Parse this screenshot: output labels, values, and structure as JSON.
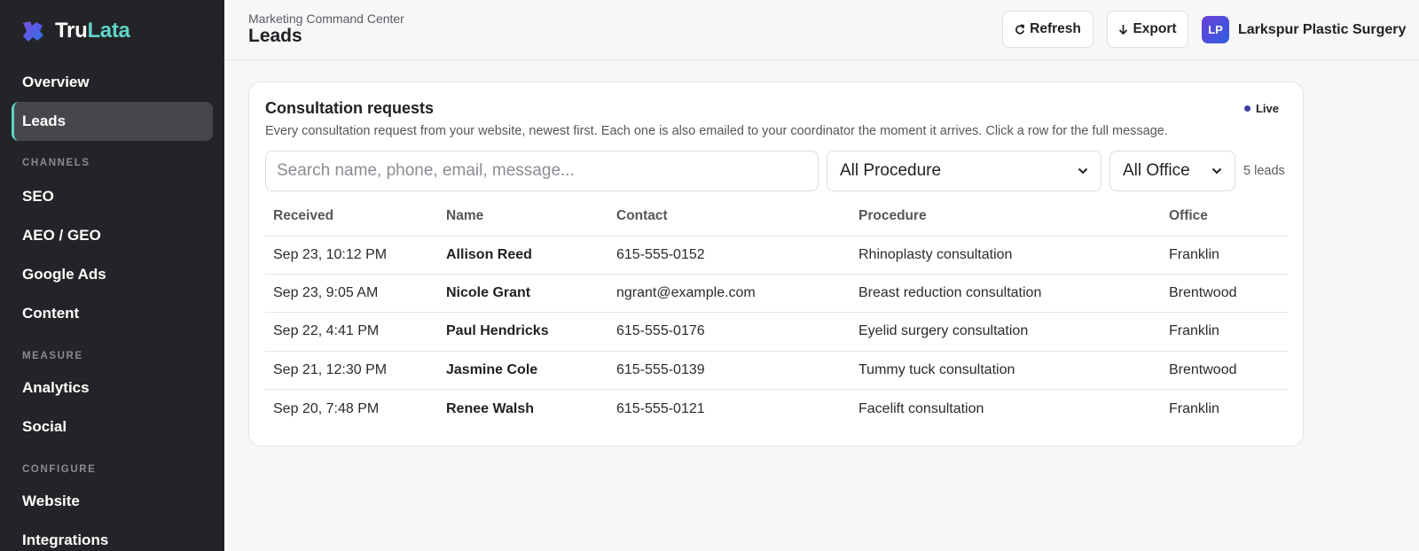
{
  "brand": {
    "prefix": "Tru",
    "suffix": "Lata"
  },
  "sidebar": {
    "items_top": [
      {
        "label": "Overview"
      },
      {
        "label": "Leads"
      }
    ],
    "section_channels": "CHANNELS",
    "items_channels": [
      {
        "label": "SEO"
      },
      {
        "label": "AEO / GEO"
      },
      {
        "label": "Google Ads"
      },
      {
        "label": "Content"
      }
    ],
    "section_measure": "MEASURE",
    "items_measure": [
      {
        "label": "Analytics"
      },
      {
        "label": "Social"
      }
    ],
    "section_configure": "CONFIGURE",
    "items_configure": [
      {
        "label": "Website"
      },
      {
        "label": "Integrations"
      }
    ]
  },
  "header": {
    "breadcrumb": "Marketing Command Center",
    "title": "Leads",
    "refresh_label": "Refresh",
    "export_label": "Export",
    "org_initials": "LP",
    "org_name": "Larkspur Plastic Surgery"
  },
  "card": {
    "title": "Consultation requests",
    "live_label": "Live",
    "description": "Every consultation request from your website, newest first. Each one is also emailed to your coordinator the moment it arrives. Click a row for the full message.",
    "search_placeholder": "Search name, phone, email, message...",
    "procedure_filter": "All Procedure",
    "office_filter": "All Office",
    "leads_count": "5 leads"
  },
  "table": {
    "columns": [
      "Received",
      "Name",
      "Contact",
      "Procedure",
      "Office"
    ],
    "rows": [
      [
        "Sep 23, 10:12 PM",
        "Allison Reed",
        "615-555-0152",
        "Rhinoplasty consultation",
        "Franklin"
      ],
      [
        "Sep 23, 9:05 AM",
        "Nicole Grant",
        "ngrant@example.com",
        "Breast reduction consultation",
        "Brentwood"
      ],
      [
        "Sep 22, 4:41 PM",
        "Paul Hendricks",
        "615-555-0176",
        "Eyelid surgery consultation",
        "Franklin"
      ],
      [
        "Sep 21, 12:30 PM",
        "Jasmine Cole",
        "615-555-0139",
        "Tummy tuck consultation",
        "Brentwood"
      ],
      [
        "Sep 20, 7:48 PM",
        "Renee Walsh",
        "615-555-0121",
        "Facelift consultation",
        "Franklin"
      ]
    ]
  },
  "colors": {
    "accent": "#5fd3c8",
    "sidebar_bg": "#232427",
    "live_dot": "#3a3fa8"
  },
  "icons": {
    "logo": "puzzle-logo-icon",
    "refresh": "refresh-icon",
    "export": "arrow-down-icon",
    "select": "chevron-down-icon"
  }
}
